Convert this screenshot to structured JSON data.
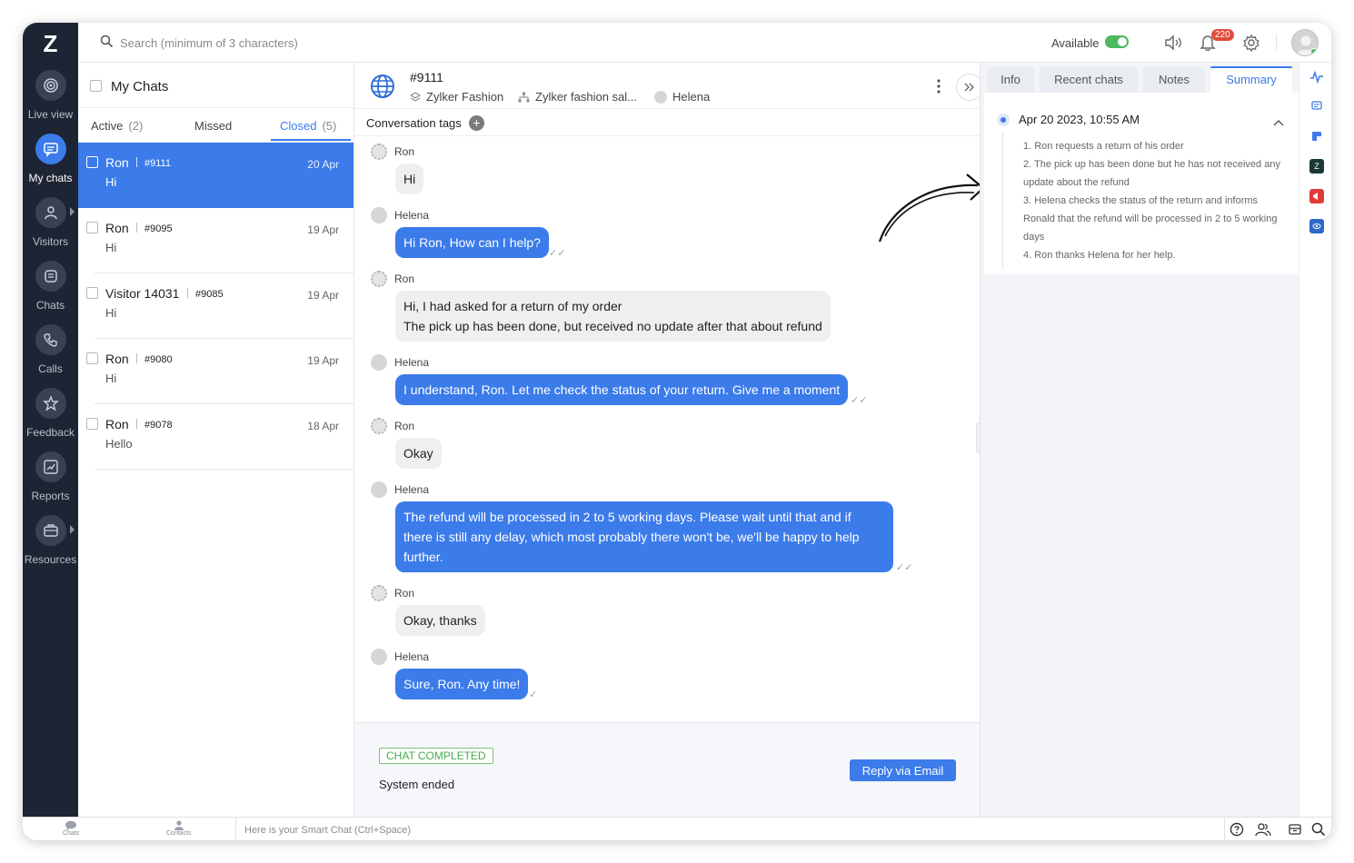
{
  "app": {
    "logo": "Z"
  },
  "nav": {
    "items": [
      {
        "label": "Live view",
        "icon": "live-view-icon"
      },
      {
        "label": "My chats",
        "icon": "chat-bubble-icon",
        "active": true
      },
      {
        "label": "Visitors",
        "icon": "person-icon"
      },
      {
        "label": "Chats",
        "icon": "chats-icon"
      },
      {
        "label": "Calls",
        "icon": "phone-icon"
      },
      {
        "label": "Feedback",
        "icon": "star-icon"
      },
      {
        "label": "Reports",
        "icon": "chart-icon"
      },
      {
        "label": "Resources",
        "icon": "briefcase-icon"
      }
    ]
  },
  "topbar": {
    "search_placeholder": "Search (minimum of 3 characters)",
    "availability": "Available",
    "notification_count": "220"
  },
  "chatlist": {
    "title": "My Chats",
    "tabs": [
      {
        "label": "Active",
        "count": "(2)"
      },
      {
        "label": "Missed",
        "count": ""
      },
      {
        "label": "Closed",
        "count": "(5)"
      }
    ],
    "rows": [
      {
        "name": "Ron",
        "id": "#9111",
        "date": "20 Apr",
        "message": "Hi"
      },
      {
        "name": "Ron",
        "id": "#9095",
        "date": "19 Apr",
        "message": "Hi"
      },
      {
        "name": "Visitor 14031",
        "id": "#9085",
        "date": "19 Apr",
        "message": "Hi"
      },
      {
        "name": "Ron",
        "id": "#9080",
        "date": "19 Apr",
        "message": "Hi"
      },
      {
        "name": "Ron",
        "id": "#9078",
        "date": "18 Apr",
        "message": "Hello"
      }
    ]
  },
  "conversation": {
    "id": "#9111",
    "brand": "Zylker Fashion",
    "department": "Zylker fashion sal...",
    "agent": "Helena",
    "tags_label": "Conversation tags",
    "messages": [
      {
        "sender": "Ron",
        "lines": [
          "Hi"
        ]
      },
      {
        "sender": "Helena",
        "lines": [
          "Hi Ron, How can I help?"
        ]
      },
      {
        "sender": "Ron",
        "lines": [
          "Hi, I had asked for a return of my order",
          "The pick up has been done, but received no update after that about refund"
        ]
      },
      {
        "sender": "Helena",
        "lines": [
          "I understand, Ron. Let me check the status of your return. Give me a moment"
        ]
      },
      {
        "sender": "Ron",
        "lines": [
          "Okay"
        ]
      },
      {
        "sender": "Helena",
        "lines": [
          "The refund will be processed in 2 to 5 working days. Please wait until that and if",
          "there is still any delay, which most probably there won't be, we'll be happy to help",
          "further."
        ]
      },
      {
        "sender": "Ron",
        "lines": [
          "Okay, thanks"
        ]
      },
      {
        "sender": "Helena",
        "lines": [
          "Sure, Ron. Any time!"
        ]
      }
    ],
    "status_badge": "CHAT COMPLETED",
    "system_text": "System ended",
    "reply_label": "Reply via Email"
  },
  "rightpanel": {
    "tabs": [
      "Info",
      "Recent chats",
      "Notes",
      "Summary"
    ],
    "summary": {
      "date": "Apr 20 2023, 10:55 AM",
      "points": [
        "1. Ron requests a return of his order",
        "2. The pick up has been done but he has not received any update about the refund",
        "3. Helena checks the status of the return and informs Ronald that the refund will be processed in 2 to 5 working days",
        "4. Ron thanks Helena for her help."
      ]
    }
  },
  "bottombar": {
    "chats_label": "Chats",
    "contacts_label": "Contacts",
    "smart_placeholder": "Here is your Smart Chat (Ctrl+Space)"
  },
  "colors": {
    "accent": "#3b7bea",
    "rail": "#1d2433",
    "online": "#4cb860",
    "badge": "#e34b3b"
  }
}
